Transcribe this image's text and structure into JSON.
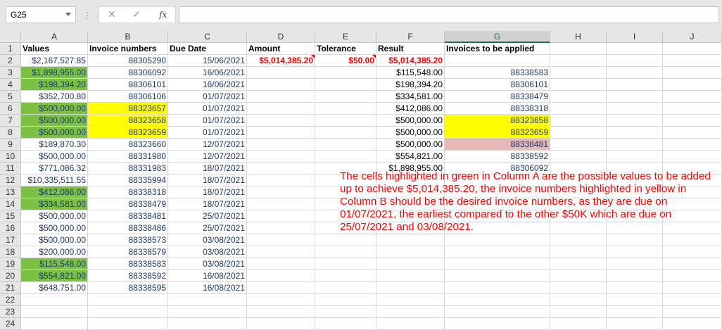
{
  "namebox": {
    "value": "G25"
  },
  "formula": {
    "cancel": "✕",
    "enter": "✓",
    "fx": "fx",
    "value": ""
  },
  "columns": [
    "A",
    "B",
    "C",
    "D",
    "E",
    "F",
    "G",
    "H",
    "I",
    "J"
  ],
  "selected_column": "G",
  "rows": [
    "1",
    "2",
    "3",
    "4",
    "5",
    "6",
    "7",
    "8",
    "9",
    "10",
    "11",
    "12",
    "13",
    "14",
    "15",
    "16",
    "17",
    "18",
    "19",
    "20",
    "21",
    "22",
    "23",
    "24"
  ],
  "headers": {
    "A": "Values",
    "B": "Invoice numbers",
    "C": "Due Date",
    "D": "Amount",
    "E": "Tolerance",
    "F": "Result",
    "G": "Invoices to be applied"
  },
  "colA": [
    "$2,167,527.85",
    "$1,898,955.00",
    "$198,394.20",
    "$352,700.80",
    "$500,000.00",
    "$500,000.00",
    "$500,000.00",
    "$189,870.30",
    "$500,000.00",
    "$771,086.32",
    "$10,335,511.55",
    "$412,086.00",
    "$334,581.00",
    "$500,000.00",
    "$500,000.00",
    "$500,000.00",
    "$200,000.00",
    "$115,548.00",
    "$554,821.00",
    "$648,751.00"
  ],
  "colA_highlight": [
    "none",
    "green",
    "green",
    "none",
    "green",
    "green",
    "green",
    "none",
    "none",
    "none",
    "none",
    "green",
    "green",
    "none",
    "none",
    "none",
    "none",
    "green",
    "green",
    "none"
  ],
  "colB": [
    "88305290",
    "88306092",
    "88306101",
    "88306106",
    "88323657",
    "88323658",
    "88323659",
    "88323660",
    "88331980",
    "88331983",
    "88335994",
    "88338318",
    "88338479",
    "88338481",
    "88338486",
    "88338573",
    "88338579",
    "88338583",
    "88338592",
    "88338595"
  ],
  "colB_highlight": [
    "none",
    "none",
    "none",
    "none",
    "yellow",
    "yellow",
    "yellow",
    "none",
    "none",
    "none",
    "none",
    "none",
    "none",
    "none",
    "none",
    "none",
    "none",
    "none",
    "none",
    "none"
  ],
  "colC": [
    "15/06/2021",
    "16/06/2021",
    "16/06/2021",
    "01/07/2021",
    "01/07/2021",
    "01/07/2021",
    "01/07/2021",
    "12/07/2021",
    "12/07/2021",
    "18/07/2021",
    "18/07/2021",
    "18/07/2021",
    "18/07/2021",
    "25/07/2021",
    "25/07/2021",
    "03/08/2021",
    "03/08/2021",
    "03/08/2021",
    "16/08/2021",
    "16/08/2021"
  ],
  "amount": "$5,014,385.20",
  "tolerance": "$50.00",
  "result_total": "$5,014,385.20",
  "colF": [
    "$115,548.00",
    "$198,394.20",
    "$334,581.00",
    "$412,086.00",
    "$500,000.00",
    "$500,000.00",
    "$500,000.00",
    "$554,821.00",
    "$1,898,955.00"
  ],
  "colG": [
    "88338583",
    "88306101",
    "88338479",
    "88338318",
    "88323658",
    "88323659",
    "88338481",
    "88338592",
    "88306092"
  ],
  "colG_highlight": [
    "none",
    "none",
    "none",
    "none",
    "yellow",
    "yellow",
    "pink",
    "none",
    "none"
  ],
  "note": "The cells highlighted in green in Column A are the possible values to be added up to achieve $5,014,385.20, the invoice numbers highlighted in yellow in Column B should be the desired invoice numbers, as they are due on 01/07/2021, the earliest compared to the other $50K which are due on 25/07/2021 and 03/08/2021.",
  "colors": {
    "green": "#7cc144",
    "yellow": "#ffff00",
    "pink": "#e6b8b7",
    "red": "#ff0000"
  }
}
